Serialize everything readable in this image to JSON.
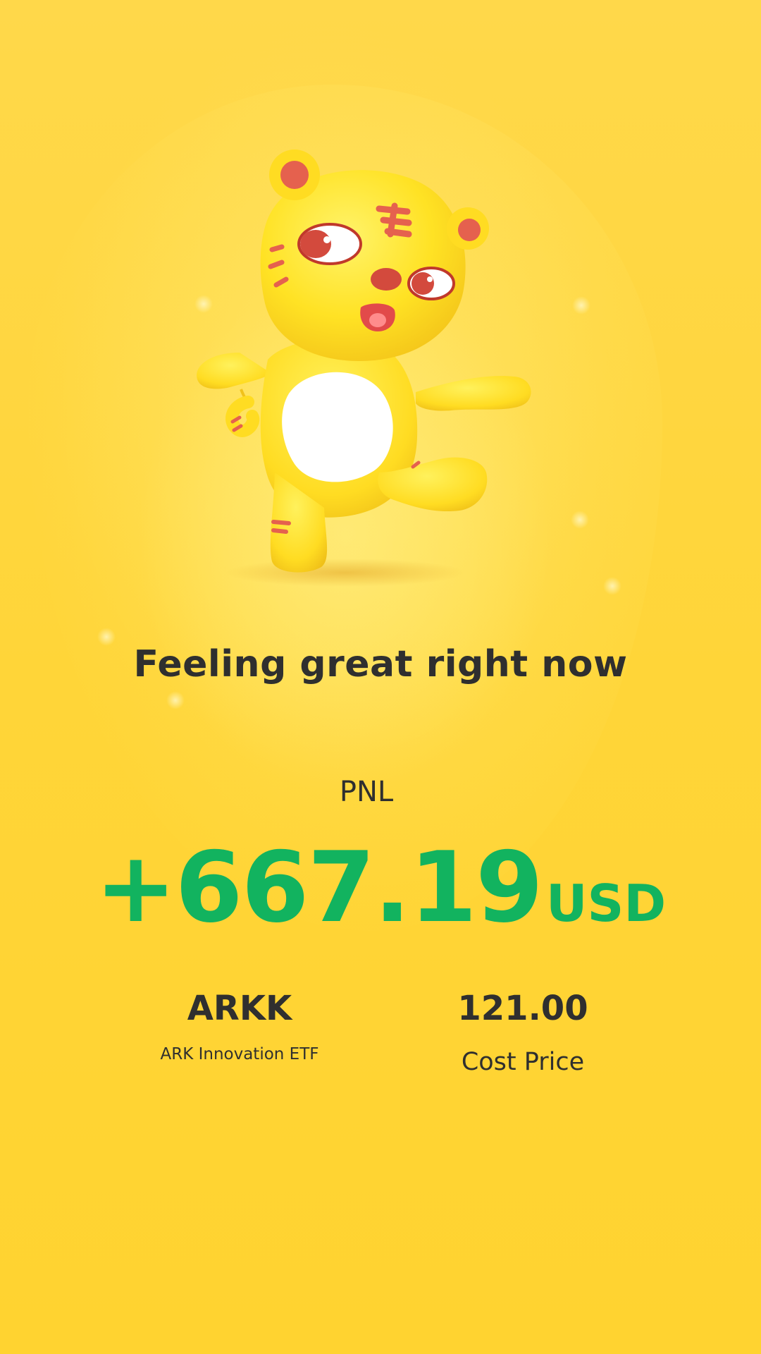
{
  "colors": {
    "background": "#ffd834",
    "text": "#2f2f2f",
    "profit": "#12b35f"
  },
  "mascot": {
    "icon": "tiger-mascot-icon"
  },
  "headline": "Feeling great right now",
  "pnl": {
    "label": "PNL",
    "value": "+667.19",
    "unit": "USD"
  },
  "security": {
    "ticker": "ARKK",
    "name": "ARK Innovation ETF"
  },
  "cost": {
    "value": "121.00",
    "label": "Cost Price"
  }
}
